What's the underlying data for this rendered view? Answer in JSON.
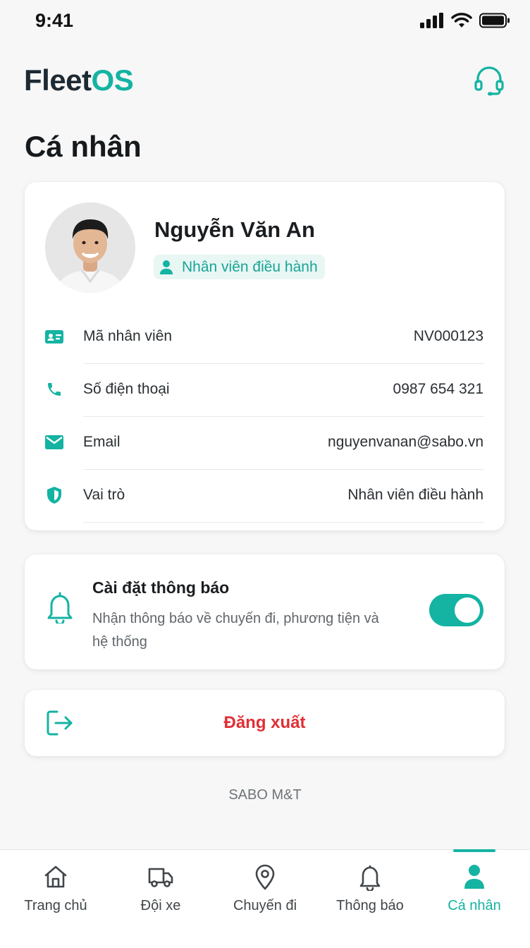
{
  "status_bar": {
    "time": "9:41"
  },
  "header": {
    "logo_part1": "Fleet",
    "logo_part2": "OS",
    "support_icon": "headset-icon"
  },
  "page": {
    "title": "Cá nhân"
  },
  "profile": {
    "name": "Nguyễn Văn An",
    "role_badge": "Nhân viên điều hành",
    "rows": [
      {
        "icon": "id-card-icon",
        "label": "Mã nhân viên",
        "value": "NV000123"
      },
      {
        "icon": "phone-icon",
        "label": "Số điện thoại",
        "value": "0987 654 321"
      },
      {
        "icon": "mail-icon",
        "label": "Email",
        "value": "nguyenvanan@sabo.vn"
      },
      {
        "icon": "shield-icon",
        "label": "Vai trò",
        "value": "Nhân viên điều hành"
      }
    ]
  },
  "notifications": {
    "title": "Cài đặt thông báo",
    "description": "Nhận thông báo về chuyến đi, phương tiện và hệ thống",
    "enabled": true
  },
  "logout": {
    "label": "Đăng xuất"
  },
  "footer": {
    "brand": "SABO M&T"
  },
  "nav": {
    "items": [
      {
        "label": "Trang chủ",
        "icon": "home-icon"
      },
      {
        "label": "Đội xe",
        "icon": "truck-icon"
      },
      {
        "label": "Chuyến đi",
        "icon": "map-pin-icon"
      },
      {
        "label": "Thông báo",
        "icon": "bell-icon"
      },
      {
        "label": "Cá nhân",
        "icon": "user-icon",
        "active": true
      }
    ]
  },
  "colors": {
    "accent": "#14b3a2",
    "danger": "#e02f35",
    "text": "#1f2428"
  }
}
